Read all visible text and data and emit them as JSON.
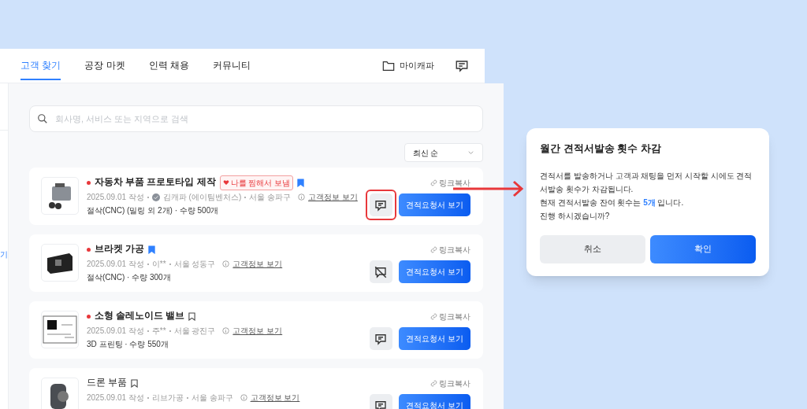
{
  "nav": {
    "tabs": [
      {
        "label": "고객 찾기",
        "selected": true
      },
      {
        "label": "공장 마켓",
        "selected": false
      },
      {
        "label": "인력 채용",
        "selected": false
      },
      {
        "label": "커뮤니티",
        "selected": false
      }
    ],
    "my_label": "마이캐파"
  },
  "sidebar": {
    "fragment": "기"
  },
  "search": {
    "placeholder": "회사명, 서비스 또는 지역으로 검색"
  },
  "sort": {
    "value": "최신 순"
  },
  "cards": [
    {
      "title": "자동차 부품 프로토타입 제작",
      "unread": true,
      "badge": "나를 찜해서 보냄",
      "bookmarked": true,
      "date": "2025.09.01 작성",
      "verified": true,
      "company": "김캐파 (에이팀벤처스)",
      "location": "서울 송파구",
      "info_link": "고객정보 보기",
      "spec": "절삭(CNC) (밀링 외 2개) · 수량 500개",
      "link_copy": "링크복사",
      "chat_enabled": true,
      "highlighted": true,
      "action": "견적요청서 보기",
      "kind": "engine"
    },
    {
      "title": "브라켓 가공",
      "unread": true,
      "bookmarked": true,
      "date": "2025.09.01 작성",
      "verified": false,
      "company": "이**",
      "location": "서울 성동구",
      "info_link": "고객정보 보기",
      "spec": "절삭(CNC) · 수량 300개",
      "link_copy": "링크복사",
      "chat_enabled": false,
      "highlighted": false,
      "action": "견적요청서 보기",
      "kind": "bracket"
    },
    {
      "title": "소형 솔레노이드 밸브",
      "unread": true,
      "bookmarked": false,
      "date": "2025.09.01 작성",
      "verified": false,
      "company": "주**",
      "location": "서울 광진구",
      "info_link": "고객정보 보기",
      "spec": "3D 프린팅 · 수량 550개",
      "link_copy": "링크복사",
      "chat_enabled": true,
      "highlighted": false,
      "action": "견적요청서 보기",
      "kind": "drawing"
    },
    {
      "title": "드론 부품",
      "unread": false,
      "bookmarked": false,
      "date": "2025.09.01 작성",
      "verified": false,
      "company": "리브가공",
      "location": "서울 송파구",
      "info_link": "고객정보 보기",
      "link_copy": "링크복사",
      "chat_enabled": true,
      "highlighted": false,
      "action": "견적요청서 보기",
      "kind": "motor"
    }
  ],
  "dialog": {
    "title": "월간 견적서발송 횟수 차감",
    "lines": [
      "견적서를 발송하거나 고객과 채팅을 먼저 시작할 시에도 견적서발송 횟수가 차감됩니다.",
      "현재 견적서발송 잔여 횟수는 **5개** 입니다.",
      "진행 하시겠습니까?"
    ],
    "cancel": "취소",
    "confirm": "확인"
  }
}
